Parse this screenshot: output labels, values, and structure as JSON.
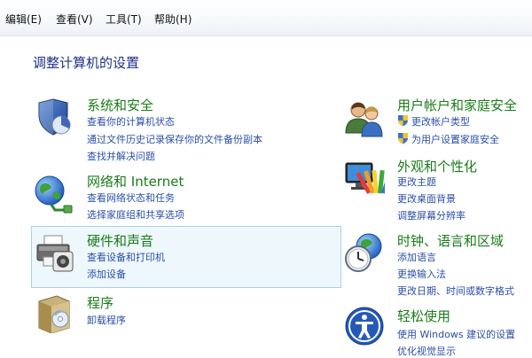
{
  "menubar": {
    "items": [
      "编辑(E)",
      "查看(V)",
      "工具(T)",
      "帮助(H)"
    ]
  },
  "page_title": "调整计算机的设置",
  "categories": {
    "system_security": {
      "title": "系统和安全",
      "links": [
        "查看你的计算机状态",
        "通过文件历史记录保存你的文件备份副本",
        "查找并解决问题"
      ]
    },
    "network_internet": {
      "title": "网络和 Internet",
      "links": [
        "查看网络状态和任务",
        "选择家庭组和共享选项"
      ]
    },
    "hardware_sound": {
      "title": "硬件和声音",
      "links": [
        "查看设备和打印机",
        "添加设备"
      ]
    },
    "programs": {
      "title": "程序",
      "links": [
        "卸载程序"
      ]
    },
    "user_accounts": {
      "title": "用户帐户和家庭安全",
      "links": [
        "更改帐户类型",
        "为用户设置家庭安全"
      ]
    },
    "appearance": {
      "title": "外观和个性化",
      "links": [
        "更改主题",
        "更改桌面背景",
        "调整屏幕分辨率"
      ]
    },
    "clock_language": {
      "title": "时钟、语言和区域",
      "links": [
        "添加语言",
        "更换输入法",
        "更改日期、时间或数字格式"
      ]
    },
    "ease_of_access": {
      "title": "轻松使用",
      "links": [
        "使用 Windows 建议的设置",
        "优化视觉显示"
      ]
    }
  },
  "colors": {
    "category_title": "#1a7c18",
    "link": "#2a4ea8",
    "page_title": "#1e3287",
    "hover_bg": "#eef7fc",
    "hover_border": "#a6d2ec"
  },
  "icons": {
    "system_security": "shield-icon",
    "network_internet": "network-globe-icon",
    "hardware_sound": "printer-icon",
    "programs": "programs-box-icon",
    "user_accounts": "users-icon",
    "appearance": "monitor-palette-icon",
    "clock_language": "clock-globe-icon",
    "ease_of_access": "ease-of-access-icon",
    "uac": "uac-shield-icon"
  }
}
